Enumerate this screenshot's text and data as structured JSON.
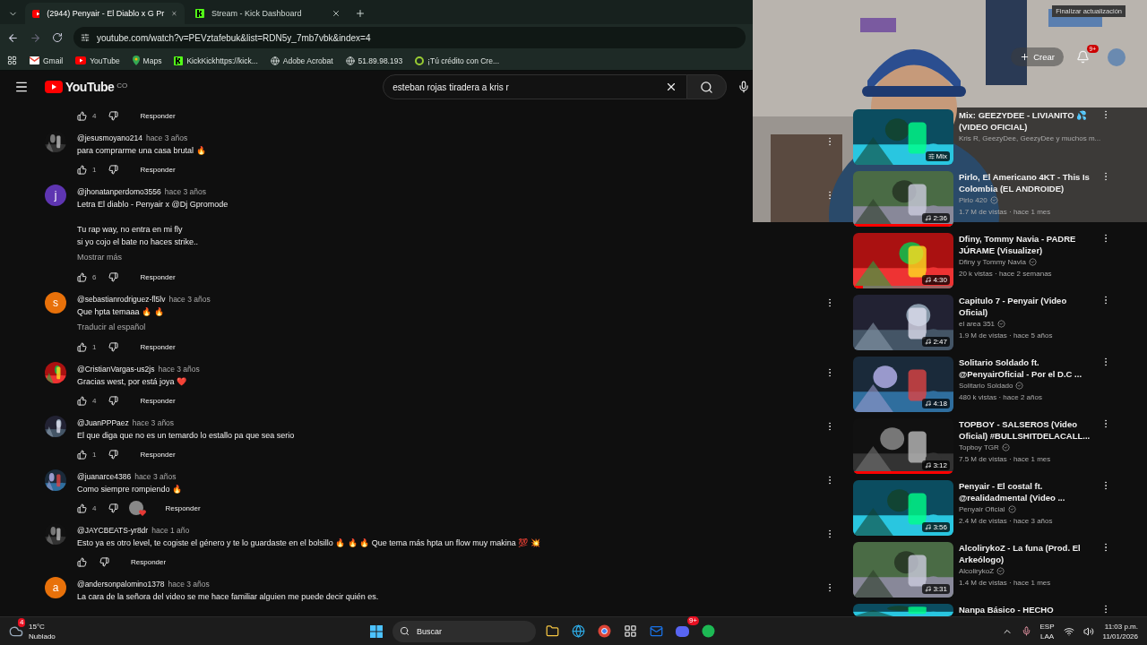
{
  "browser": {
    "tabs": [
      {
        "title": "(2944) Penyair - El Diablo x G Pr",
        "selected": true
      },
      {
        "title": "Stream - Kick Dashboard",
        "selected": false
      }
    ],
    "address": "youtube.com/watch?v=PEVztafebuk&list=RDN5y_7mb7vbk&index=4",
    "bookmarks": [
      "Gmail",
      "YouTube",
      "Maps",
      "KickKickhttps://kick...",
      "Adobe Acrobat",
      "51.89.98.193",
      "¡Tú crédito con Cre..."
    ],
    "update_button": "Finalizar actualización"
  },
  "youtube": {
    "logo": "YouTube",
    "country": "CO",
    "search": "esteban rojas tiradera a kris r",
    "create": "Crear",
    "notifications": "9+"
  },
  "comments": [
    {
      "likes": "4",
      "creator_heart": false,
      "reply": "Responder",
      "avatar": {
        "kind": "none"
      }
    },
    {
      "author": "@jesusmoyano214",
      "time": "hace 3 años",
      "text": "para comprarme una casa brutal 🔥",
      "likes": "1",
      "creator_heart": false,
      "reply": "Responder"
    },
    {
      "author": "@jhonatanperdomo3556",
      "time": "hace 3 años",
      "text": "Letra El diablo - Penyair x @Dj Gpromode\n\nTu rap way, no entra en mi fly\nsi yo cojo el bate no haces strike..",
      "more": "Mostrar más",
      "likes": "6",
      "creator_heart": false,
      "reply": "Responder",
      "avatar": {
        "kind": "letter",
        "letter": "j",
        "color": "#5e35b1"
      }
    },
    {
      "author": "@sebastianrodriguez-fl5lv",
      "time": "hace 3 años",
      "text": "Que hpta temaaa 🔥 🔥",
      "more": "Traducir al español",
      "likes": "1",
      "creator_heart": false,
      "reply": "Responder",
      "avatar": {
        "kind": "letter",
        "letter": "s",
        "color": "#e8710a"
      }
    },
    {
      "author": "@CristianVargas-us2js",
      "time": "hace 3 años",
      "text": "Gracias west, por está joya ❤️",
      "likes": "4",
      "creator_heart": false,
      "reply": "Responder"
    },
    {
      "author": "@JuanPPPaez",
      "time": "hace 3 años",
      "text": "El que diga que no es un temardo lo estallo pa que sea serio",
      "likes": "1",
      "creator_heart": false,
      "reply": "Responder"
    },
    {
      "author": "@juanarce4386",
      "time": "hace 3 años",
      "text": "Como siempre rompiendo 🔥",
      "likes": "4",
      "creator_heart": true,
      "reply": "Responder"
    },
    {
      "author": "@JAYCBEATS-yr8dr",
      "time": "hace 1 año",
      "text": "Esto ya es otro level, te cogiste el género y te lo guardaste en el bolsillo 🔥 🔥 🔥  Que tema más hpta un flow muy makina 💯 💥",
      "creator_heart": false,
      "reply": "Responder"
    },
    {
      "author": "@andersonpalomino1378",
      "time": "hace 3 años",
      "text": "La cara de la señora del video se me hace familiar alguien me puede decir quién es.",
      "avatar": {
        "kind": "letter",
        "letter": "a",
        "color": "#e8710a"
      }
    }
  ],
  "related": [
    {
      "kind": "mix",
      "title": "Mix: GEEZYDEE - LIVIANITO 💦 (VIDEO OFICIAL)",
      "channel": "Kris R, GeezyDee, GeezyDee y muchos m...",
      "badge": "Mix"
    },
    {
      "kind": "video",
      "title": "Pirlo, El Americano 4KT - This Is Colombia (EL ANDROIDE)",
      "channel": "Pirlo 420",
      "meta": "1.7 M de vistas · hace 1 mes",
      "badge": "2:36",
      "level": 1
    },
    {
      "kind": "video",
      "title": "Dfiny, Tommy Navia - PADRE JÚRAME (Visualizer)",
      "channel": "Dfiny y Tommy Navia",
      "meta": "20 k vistas · hace 2 semanas",
      "badge": "4:30",
      "level": 0.1
    },
    {
      "kind": "video",
      "title": "Capitulo 7 - Penyair (Video Oficial)",
      "channel": "el area 351",
      "meta": "1.9 M de vistas · hace 5 años",
      "badge": "2:47"
    },
    {
      "kind": "video",
      "title": "Solitario Soldado ft. @PenyairOficial  - Por el D.C ...",
      "channel": "Solitario Soldado",
      "meta": "480 k vistas · hace 2 años",
      "badge": "4:18"
    },
    {
      "kind": "video",
      "title": "TOPBOY - SALSEROS (Video Oficial) #BULLSHITDELACALL...",
      "channel": "Topboy TGR",
      "meta": "7.5 M de vistas · hace 1 mes",
      "badge": "3:12",
      "level": 1
    },
    {
      "kind": "video",
      "title": "Penyair - El costal ft. @realidadmental (Video ...",
      "channel": "Penyair Oficial",
      "meta": "2.4 M de vistas · hace 3 años",
      "badge": "3:56"
    },
    {
      "kind": "video",
      "title": "AlcolirykoZ - La funa (Prod. El Arkeólogo)",
      "channel": "AlcolirykoZ",
      "meta": "1.4 M de vistas · hace 1 mes",
      "badge": "3:31"
    },
    {
      "kind": "cut",
      "title": "Nanpa Básico - HECHO"
    }
  ],
  "taskbar": {
    "temperature": "15°C",
    "weather": "Nublado",
    "weather_badge": "4",
    "search": "Buscar",
    "discord_badge": "9+",
    "language": "ESP",
    "layout": "LAA",
    "time": "11:03 p.m.",
    "date": "11/01/2026"
  }
}
